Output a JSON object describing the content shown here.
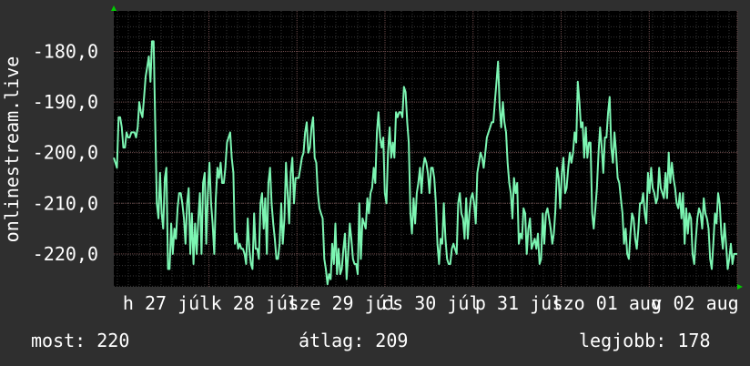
{
  "chart_data": {
    "type": "line",
    "ylabel": "onlinestream.live",
    "y_ticks": [
      -180,
      -190,
      -200,
      -210,
      -220
    ],
    "y_tick_labels": [
      "-180,0",
      "-190,0",
      "-200,0",
      "-210,0",
      "-220,0"
    ],
    "ylim": [
      -226.5,
      -172
    ],
    "x_tick_labels": [
      "h 27 júl",
      "k 28 júl",
      "sze 29 júl",
      "cs 30 júl",
      "p 31 júl",
      "szo 01 aug",
      "v 02 aug"
    ],
    "grid": true,
    "series": [
      {
        "color": "#7cf5b2",
        "values": [
          -201,
          -202,
          -203,
          -193,
          -193,
          -195,
          -199,
          -199,
          -196,
          -197,
          -197,
          -196,
          -196,
          -196,
          -197,
          -195,
          -190,
          -192,
          -193,
          -189,
          -185,
          -183,
          -181,
          -186,
          -178,
          -178,
          -194,
          -210,
          -213,
          -204,
          -212,
          -215,
          -205,
          -203,
          -223,
          -223,
          -214,
          -220,
          -215,
          -217,
          -211,
          -208,
          -208,
          -210,
          -213,
          -218,
          -210,
          -207,
          -220,
          -212,
          -222,
          -214,
          -220,
          -213,
          -208,
          -220,
          -206,
          -204,
          -218,
          -208,
          -202,
          -210,
          -214,
          -220,
          -209,
          -203,
          -205,
          -202,
          -206,
          -206,
          -203,
          -198,
          -197,
          -196,
          -201,
          -204,
          -218,
          -216,
          -219,
          -218,
          -219,
          -219,
          -220,
          -222,
          -213,
          -219,
          -222,
          -223,
          -212,
          -219,
          -219,
          -221,
          -210,
          -208,
          -215,
          -209,
          -220,
          -206,
          -203,
          -210,
          -214,
          -217,
          -221,
          -221,
          -218,
          -210,
          -218,
          -213,
          -202,
          -208,
          -214,
          -204,
          -201,
          -210,
          -205,
          -205,
          -205,
          -203,
          -201,
          -200,
          -196,
          -194,
          -200,
          -199,
          -195,
          -193,
          -201,
          -202,
          -208,
          -211,
          -212,
          -213,
          -221,
          -223,
          -226,
          -224,
          -225,
          -218,
          -222,
          -214,
          -224,
          -219,
          -224,
          -223,
          -219,
          -216,
          -225,
          -220,
          -214,
          -217,
          -221,
          -222,
          -222,
          -224,
          -210,
          -221,
          -213,
          -214,
          -215,
          -209,
          -212,
          -208,
          -207,
          -203,
          -206,
          -196,
          -192,
          -197,
          -199,
          -197,
          -208,
          -210,
          -200,
          -195,
          -201,
          -198,
          -201,
          -192,
          -193,
          -192,
          -192,
          -193,
          -187,
          -188,
          -194,
          -198,
          -212,
          -216,
          -209,
          -214,
          -208,
          -206,
          -203,
          -208,
          -203,
          -201,
          -202,
          -204,
          -208,
          -203,
          -203,
          -205,
          -210,
          -218,
          -222,
          -217,
          -218,
          -210,
          -217,
          -221,
          -222,
          -222,
          -219,
          -218,
          -219,
          -220,
          -210,
          -208,
          -212,
          -213,
          -217,
          -209,
          -217,
          -212,
          -209,
          -208,
          -210,
          -214,
          -204,
          -202,
          -200,
          -201,
          -203,
          -200,
          -197,
          -196,
          -195,
          -194,
          -194,
          -190,
          -186,
          -182,
          -191,
          -195,
          -190,
          -194,
          -196,
          -202,
          -206,
          -208,
          -213,
          -205,
          -208,
          -206,
          -218,
          -216,
          -217,
          -211,
          -212,
          -220,
          -215,
          -213,
          -219,
          -218,
          -217,
          -219,
          -216,
          -222,
          -221,
          -212,
          -218,
          -212,
          -211,
          -213,
          -215,
          -218,
          -216,
          -211,
          -203,
          -205,
          -211,
          -204,
          -201,
          -208,
          -207,
          -203,
          -200,
          -202,
          -200,
          -196,
          -198,
          -186,
          -190,
          -195,
          -194,
          -201,
          -195,
          -201,
          -198,
          -198,
          -212,
          -215,
          -211,
          -207,
          -200,
          -195,
          -199,
          -204,
          -197,
          -197,
          -192,
          -189,
          -199,
          -202,
          -196,
          -200,
          -205,
          -206,
          -209,
          -212,
          -218,
          -215,
          -220,
          -221,
          -216,
          -212,
          -213,
          -217,
          -219,
          -215,
          -210,
          -210,
          -208,
          -212,
          -214,
          -204,
          -208,
          -203,
          -207,
          -208,
          -210,
          -209,
          -203,
          -207,
          -208,
          -209,
          -204,
          -209,
          -200,
          -206,
          -202,
          -205,
          -207,
          -210,
          -211,
          -208,
          -213,
          -208,
          -218,
          -211,
          -216,
          -212,
          -213,
          -220,
          -222,
          -217,
          -213,
          -211,
          -212,
          -215,
          -209,
          -212,
          -213,
          -215,
          -221,
          -223,
          -218,
          -212,
          -214,
          -208,
          -210,
          -216,
          -219,
          -214,
          -218,
          -223,
          -221,
          -218,
          -222,
          -220,
          -220,
          -220
        ]
      }
    ],
    "axis_arrow_color": "#00cc00"
  },
  "stats": {
    "now": "most: 220",
    "avg": "átlag: 209",
    "best": "legjobb: 178"
  }
}
